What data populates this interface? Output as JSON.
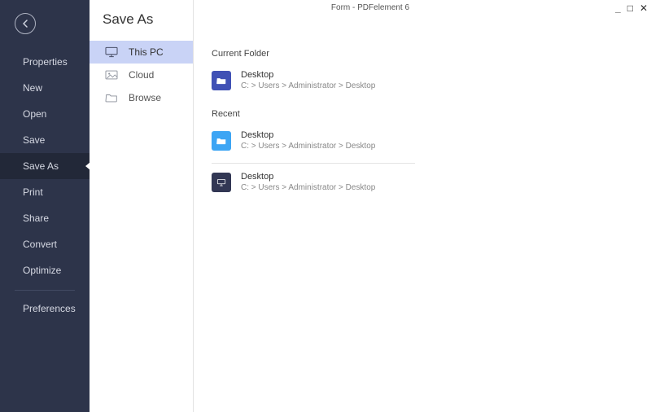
{
  "window": {
    "title": "Form - PDFelement 6"
  },
  "sidebar": {
    "items": [
      {
        "label": "Properties"
      },
      {
        "label": "New"
      },
      {
        "label": "Open"
      },
      {
        "label": "Save"
      },
      {
        "label": "Save As"
      },
      {
        "label": "Print"
      },
      {
        "label": "Share"
      },
      {
        "label": "Convert"
      },
      {
        "label": "Optimize"
      }
    ],
    "preferences_label": "Preferences"
  },
  "page": {
    "title": "Save As"
  },
  "locations": {
    "this_pc": "This PC",
    "cloud": "Cloud",
    "browse": "Browse"
  },
  "main": {
    "current_folder_label": "Current Folder",
    "recent_label": "Recent",
    "entries": {
      "current": {
        "name": "Desktop",
        "path": "C: > Users > Administrator > Desktop"
      },
      "recent1": {
        "name": "Desktop",
        "path": "C: > Users > Administrator > Desktop"
      },
      "recent2": {
        "name": "Desktop",
        "path": "C: > Users > Administrator > Desktop"
      }
    }
  }
}
